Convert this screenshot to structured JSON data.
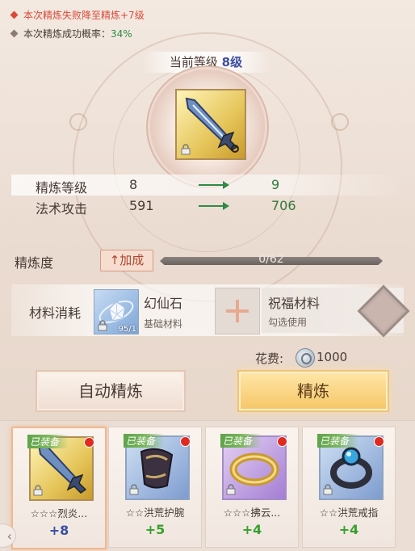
{
  "tips": [
    {
      "text": "本次精炼失败降至精炼+7级",
      "color": "#d94a3a"
    },
    {
      "label": "本次精炼成功概率：",
      "value": "34%"
    }
  ],
  "current_level": {
    "label": "当前等级",
    "value": "8级"
  },
  "stats": [
    {
      "name": "精炼等级",
      "current": "8",
      "next": "9"
    },
    {
      "name": "法术攻击",
      "current": "591",
      "next": "706"
    }
  ],
  "refine_progress": {
    "label": "精炼度",
    "boost_label": "↑加成",
    "text": "0/62",
    "fraction": 0.0
  },
  "materials": {
    "label": "材料消耗",
    "main": {
      "name": "幻仙石",
      "sub": "基础材料",
      "count": "95/1",
      "icon": "crystal-icon"
    },
    "bless": {
      "name": "祝福材料",
      "sub": "勾选使用",
      "icon": "diamond-icon"
    }
  },
  "cost": {
    "label": "花费:",
    "value": "1000",
    "icon": "silver-coin-icon"
  },
  "buttons": {
    "auto": "自动精炼",
    "refine": "精炼"
  },
  "equipment": [
    {
      "tag": "已装备",
      "name": "☆☆☆烈炎...",
      "level": "+8",
      "level_color": "blue",
      "icon": "sword-icon",
      "selected": true
    },
    {
      "tag": "已装备",
      "name": "☆☆洪荒护腕",
      "level": "+5",
      "level_color": "green",
      "icon": "bracer-icon",
      "selected": false
    },
    {
      "tag": "已装备",
      "name": "☆☆☆拂云...",
      "level": "+4",
      "level_color": "green",
      "icon": "bracelet-icon",
      "selected": false
    },
    {
      "tag": "已装备",
      "name": "☆☆洪荒戒指",
      "level": "+4",
      "level_color": "green",
      "icon": "ring-icon",
      "selected": false
    }
  ],
  "colors": {
    "accent_gold": "#f5c666",
    "level_blue": "#3a4fa5",
    "stat_green": "#2f7a3a",
    "equip_green": "#5fa34a"
  }
}
